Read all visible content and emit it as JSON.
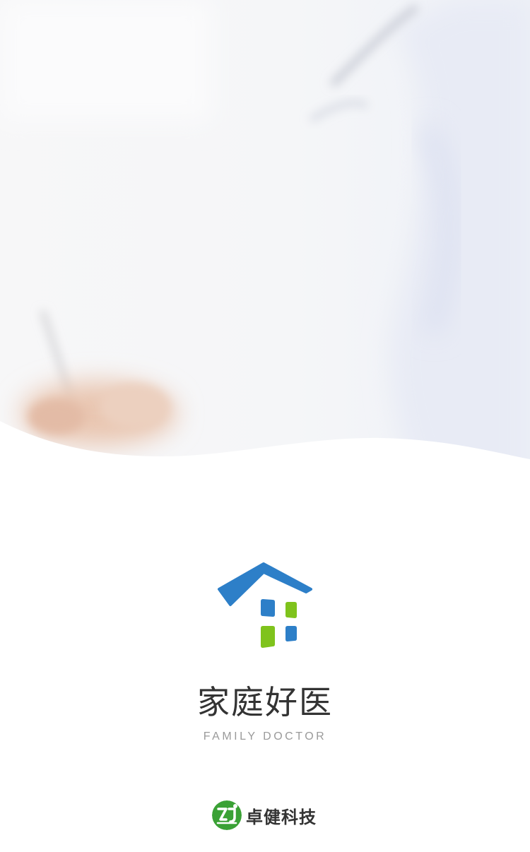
{
  "app": {
    "name": "家庭好医",
    "subtitle": "FAMILY DOCTOR"
  },
  "company": {
    "name": "卓健科技",
    "logo_text": "ZJ"
  },
  "colors": {
    "logo_blue": "#2d7fc8",
    "logo_green": "#7fc31c",
    "company_green": "#3aa135"
  },
  "icons": {
    "app_logo": "house-logo-icon",
    "company_logo": "company-logo-icon"
  }
}
